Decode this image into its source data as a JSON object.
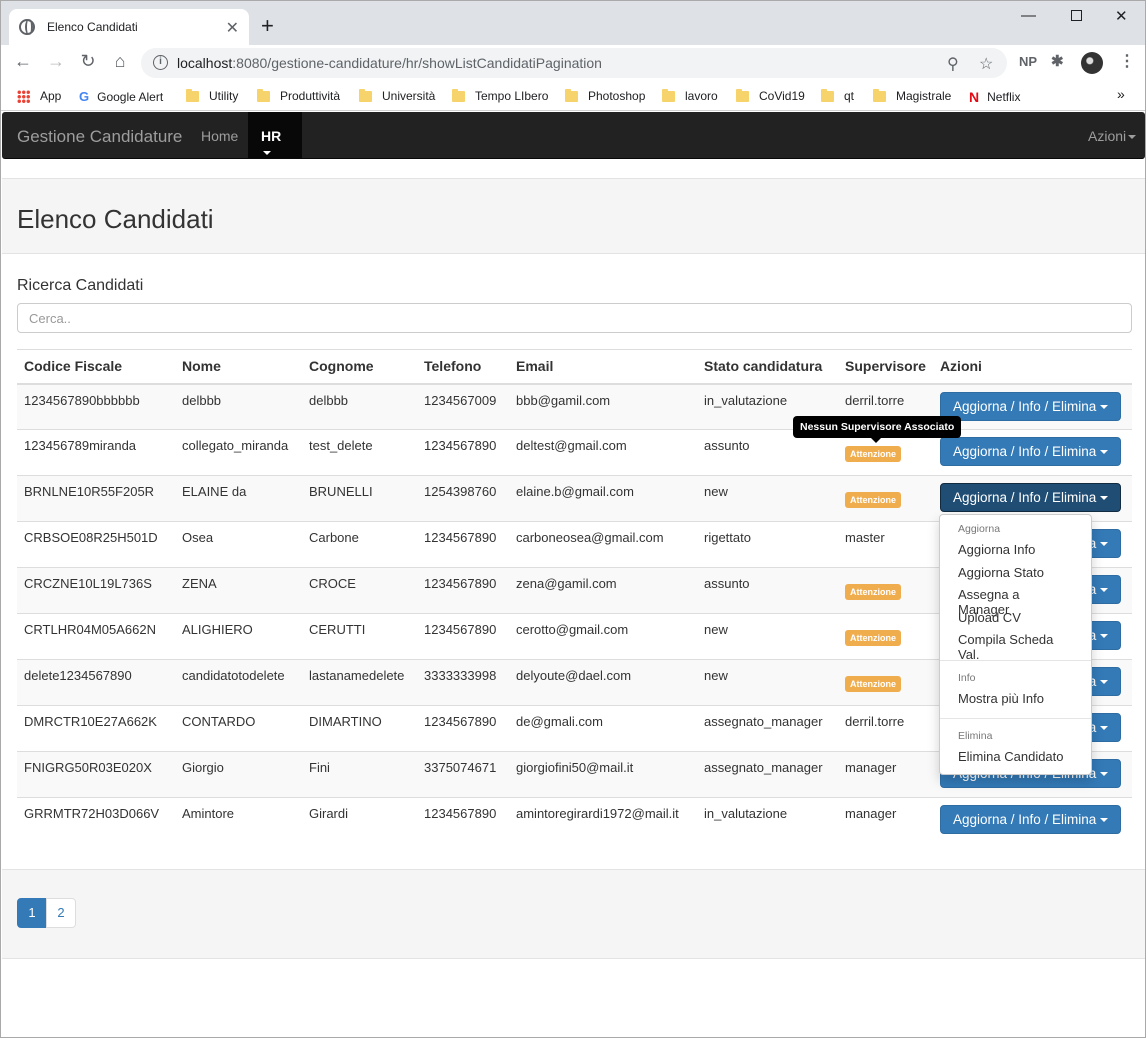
{
  "browser": {
    "tab_title": "Elenco Candidati",
    "url_host": "localhost",
    "url_path": ":8080/gestione-candidature/hr/showListCandidatiPagination",
    "ext_label": "NP",
    "bookmarks": [
      {
        "label": "App",
        "icon": "apps-grid-icon"
      },
      {
        "label": "Google Alert",
        "icon": "google-icon"
      },
      {
        "label": "Utility",
        "icon": "folder-icon"
      },
      {
        "label": "Produttività",
        "icon": "folder-icon"
      },
      {
        "label": "Università",
        "icon": "folder-icon"
      },
      {
        "label": "Tempo LIbero",
        "icon": "folder-icon"
      },
      {
        "label": "Photoshop",
        "icon": "folder-icon"
      },
      {
        "label": "lavoro",
        "icon": "folder-icon"
      },
      {
        "label": "CoVid19",
        "icon": "folder-icon"
      },
      {
        "label": "qt",
        "icon": "folder-icon"
      },
      {
        "label": "Magistrale",
        "icon": "folder-icon"
      },
      {
        "label": "Netflix",
        "icon": "netflix-icon"
      }
    ]
  },
  "navbar": {
    "brand": "Gestione Candidature",
    "home": "Home",
    "hr": "HR",
    "azioni": "Azioni"
  },
  "page": {
    "title": "Elenco Candidati",
    "search_title": "Ricerca Candidati",
    "search_placeholder": "Cerca.."
  },
  "table": {
    "headers": [
      "Codice Fiscale",
      "Nome",
      "Cognome",
      "Telefono",
      "Email",
      "Stato candidatura",
      "Supervisore",
      "Azioni"
    ],
    "action_label": "Aggiorna / Info / Elimina",
    "warning_badge": "Attenzione",
    "rows": [
      {
        "cf": "1234567890bbbbbb",
        "nome": "delbbb",
        "cognome": "delbbb",
        "tel": "1234567009",
        "email": "bbb@gamil.com",
        "stato": "in_valutazione",
        "supervisore": "derril.torre"
      },
      {
        "cf": "123456789miranda",
        "nome": "collegato_miranda",
        "cognome": "test_delete",
        "tel": "1234567890",
        "email": "deltest@gmail.com",
        "stato": "assunto",
        "supervisore": ""
      },
      {
        "cf": "BRNLNE10R55F205R",
        "nome": "ELAINE da",
        "cognome": "BRUNELLI",
        "tel": "1254398760",
        "email": "elaine.b@gmail.com",
        "stato": "new",
        "supervisore": ""
      },
      {
        "cf": "CRBSOE08R25H501D",
        "nome": "Osea",
        "cognome": "Carbone",
        "tel": "1234567890",
        "email": "carboneosea@gmail.com",
        "stato": "rigettato",
        "supervisore": "master"
      },
      {
        "cf": "CRCZNE10L19L736S",
        "nome": "ZENA",
        "cognome": "CROCE",
        "tel": "1234567890",
        "email": "zena@gamil.com",
        "stato": "assunto",
        "supervisore": ""
      },
      {
        "cf": "CRTLHR04M05A662N",
        "nome": "ALIGHIERO",
        "cognome": "CERUTTI",
        "tel": "1234567890",
        "email": "cerotto@gmail.com",
        "stato": "new",
        "supervisore": ""
      },
      {
        "cf": "delete1234567890",
        "nome": "candidatotodelete",
        "cognome": "lastanamedelete",
        "tel": "3333333998",
        "email": "delyoute@dael.com",
        "stato": "new",
        "supervisore": ""
      },
      {
        "cf": "DMRCTR10E27A662K",
        "nome": "CONTARDO",
        "cognome": "DIMARTINO",
        "tel": "1234567890",
        "email": "de@gmali.com",
        "stato": "assegnato_manager",
        "supervisore": "derril.torre"
      },
      {
        "cf": "FNIGRG50R03E020X",
        "nome": "Giorgio",
        "cognome": "Fini",
        "tel": "3375074671",
        "email": "giorgiofini50@mail.it",
        "stato": "assegnato_manager",
        "supervisore": "manager"
      },
      {
        "cf": "GRRMTR72H03D066V",
        "nome": "Amintore",
        "cognome": "Girardi",
        "tel": "1234567890",
        "email": "amintoregirardi1972@mail.it",
        "stato": "in_valutazione",
        "supervisore": "manager"
      }
    ]
  },
  "tooltip": "Nessun Supervisore Associato",
  "dropdown": {
    "h1": "Aggiorna",
    "i1": "Aggiorna Info",
    "i2": "Aggiorna Stato",
    "i3": "Assegna a Manager",
    "i4": "Upload CV",
    "i5": "Compila Scheda Val.",
    "h2": "Info",
    "i6": "Mostra più Info",
    "h3": "Elimina",
    "i7": "Elimina Candidato"
  },
  "pagination": [
    "1",
    "2"
  ],
  "colors": {
    "primary": "#337ab7",
    "warning": "#f0ad4e",
    "navbar": "#222222"
  }
}
